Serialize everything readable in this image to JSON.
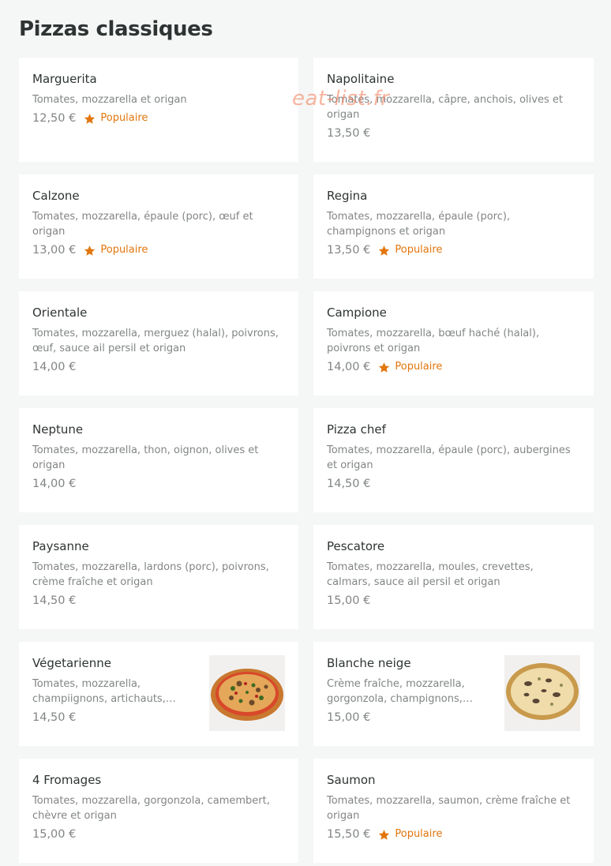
{
  "section": {
    "title": "Pizzas classiques"
  },
  "watermark": "eat-list.fr",
  "popular_label": "Populaire",
  "accent_color": "#e2760d",
  "items": [
    {
      "name": "Marguerita",
      "desc": "Tomates, mozzarella et origan",
      "price": "12,50 €",
      "popular": true,
      "image": null
    },
    {
      "name": "Napolitaine",
      "desc": "Tomates, mozzarella, câpre, anchois, olives et origan",
      "price": "13,50 €",
      "popular": false,
      "image": null
    },
    {
      "name": "Calzone",
      "desc": "Tomates, mozzarella, épaule (porc), œuf et origan",
      "price": "13,00 €",
      "popular": true,
      "image": null
    },
    {
      "name": "Regina",
      "desc": "Tomates, mozzarella, épaule (porc), champignons et origan",
      "price": "13,50 €",
      "popular": true,
      "image": null
    },
    {
      "name": "Orientale",
      "desc": "Tomates, mozzarella, merguez (halal), poivrons, œuf, sauce ail persil et origan",
      "price": "14,00 €",
      "popular": false,
      "image": null
    },
    {
      "name": "Campione",
      "desc": "Tomates, mozzarella, bœuf haché (halal), poivrons et origan",
      "price": "14,00 €",
      "popular": true,
      "image": null
    },
    {
      "name": "Neptune",
      "desc": "Tomates, mozzarella, thon, oignon, olives et origan",
      "price": "14,00 €",
      "popular": false,
      "image": null
    },
    {
      "name": "Pizza chef",
      "desc": "Tomates, mozzarella, épaule (porc), aubergines et origan",
      "price": "14,50 €",
      "popular": false,
      "image": null
    },
    {
      "name": "Paysanne",
      "desc": "Tomates, mozzarella, lardons (porc), poivrons, crème fraîche et origan",
      "price": "14,50 €",
      "popular": false,
      "image": null
    },
    {
      "name": "Pescatore",
      "desc": "Tomates, mozzarella, moules, crevettes, calmars, sauce ail persil et origan",
      "price": "15,00 €",
      "popular": false,
      "image": null
    },
    {
      "name": "Végetarienne",
      "desc": "Tomates, mozzarella, champiignons, artichauts, aube...",
      "price": "14,50 €",
      "popular": false,
      "image": "pizza-vegetarienne"
    },
    {
      "name": "Blanche neige",
      "desc": "Crème fraîche, mozzarella, gorgonzola, champignons, aub...",
      "price": "15,00 €",
      "popular": false,
      "image": "pizza-blanche-neige"
    },
    {
      "name": "4 Fromages",
      "desc": "Tomates, mozzarella, gorgonzola, camembert, chèvre et origan",
      "price": "15,00 €",
      "popular": false,
      "image": null
    },
    {
      "name": "Saumon",
      "desc": "Tomates, mozzarella, saumon, crème fraîche et origan",
      "price": "15,50 €",
      "popular": true,
      "image": null
    }
  ]
}
